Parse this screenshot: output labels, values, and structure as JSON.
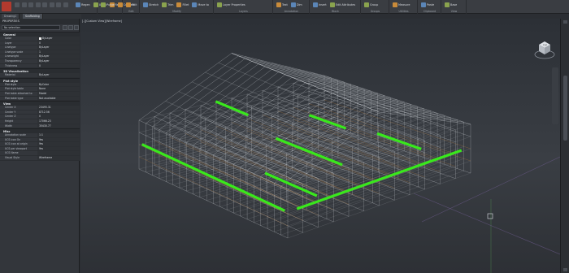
{
  "ribbon": {
    "groups": [
      {
        "name": "",
        "buttons": [
          "Regen",
          "Undo",
          "Redo"
        ]
      },
      {
        "name": "",
        "buttons": [
          "Purge",
          "Convert"
        ]
      },
      {
        "name": "Edit",
        "buttons": [
          "Edit"
        ]
      },
      {
        "name": "Modify",
        "buttons": [
          "Stretch",
          "Trim",
          "Fillet",
          "Move to"
        ]
      },
      {
        "name": "Layers",
        "buttons": [
          "Layer Properties"
        ]
      },
      {
        "name": "Annotation",
        "buttons": [
          "Text",
          "Dim"
        ]
      },
      {
        "name": "Block",
        "buttons": [
          "Insert",
          "Edit Attributes"
        ]
      },
      {
        "name": "Groups",
        "buttons": [
          "Group"
        ]
      },
      {
        "name": "Utilities",
        "buttons": [
          "Measure"
        ]
      },
      {
        "name": "Clipboard",
        "buttons": [
          "Paste"
        ]
      },
      {
        "name": "View",
        "buttons": [
          "Base"
        ]
      }
    ]
  },
  "doc_tabs": [
    "Drawing1",
    "Scaffolding"
  ],
  "palette": {
    "title": "PROPERTIES",
    "selection": "No selection",
    "sections": [
      {
        "name": "General",
        "rows": [
          {
            "k": "Color",
            "v": "ByLayer",
            "swatch": true
          },
          {
            "k": "Layer",
            "v": "0"
          },
          {
            "k": "Linetype",
            "v": "ByLayer"
          },
          {
            "k": "Linetype scale",
            "v": "1"
          },
          {
            "k": "Lineweight",
            "v": "ByLayer"
          },
          {
            "k": "Transparency",
            "v": "ByLayer"
          },
          {
            "k": "Thickness",
            "v": "0"
          }
        ]
      },
      {
        "name": "3D Visualization",
        "rows": [
          {
            "k": "Material",
            "v": "ByLayer"
          }
        ]
      },
      {
        "name": "Plot style",
        "rows": [
          {
            "k": "Plot style",
            "v": "ByColor"
          },
          {
            "k": "Plot style table",
            "v": "None"
          },
          {
            "k": "Plot table attached to",
            "v": "Model"
          },
          {
            "k": "Plot table type",
            "v": "Not available"
          }
        ]
      },
      {
        "name": "View",
        "rows": [
          {
            "k": "Center X",
            "v": "23495.31"
          },
          {
            "k": "Center Y",
            "v": "8712.56"
          },
          {
            "k": "Center Z",
            "v": "0"
          },
          {
            "k": "Height",
            "v": "17066.23"
          },
          {
            "k": "Width",
            "v": "35430.77"
          }
        ]
      },
      {
        "name": "Misc",
        "rows": [
          {
            "k": "Annotation scale",
            "v": "1:1"
          },
          {
            "k": "UCS icon On",
            "v": "Yes"
          },
          {
            "k": "UCS icon at origin",
            "v": "Yes"
          },
          {
            "k": "UCS per viewport",
            "v": "Yes"
          },
          {
            "k": "UCS Name",
            "v": ""
          },
          {
            "k": "Visual Style",
            "v": "Wireframe"
          }
        ]
      }
    ]
  },
  "viewport": {
    "label": "[-][Custom View][Wireframe]",
    "viewcube_label": "TOP"
  },
  "colors": {
    "deck": "#39e81c",
    "ledger": "#c9873f",
    "wire": "#e8ecf0",
    "background": "#33373c"
  }
}
